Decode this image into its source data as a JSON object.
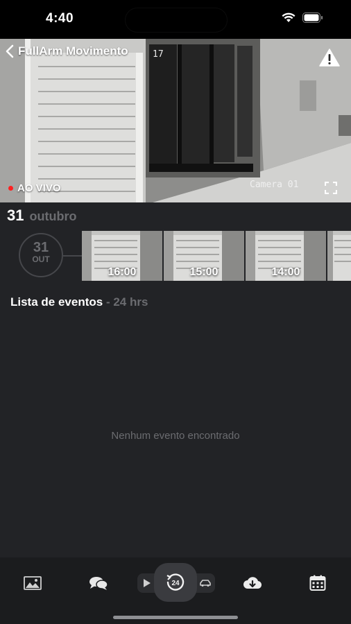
{
  "status_bar": {
    "time": "4:40"
  },
  "camera": {
    "title": "FullArm Movimento",
    "osd_time": "17",
    "live_label": "AO VIVO",
    "osd_camera": "Camera 01"
  },
  "date": {
    "day": "31",
    "month": "outubro"
  },
  "timeline": {
    "day": "31",
    "month_short": "OUT",
    "thumbnails": [
      {
        "time": "16:00"
      },
      {
        "time": "15:00"
      },
      {
        "time": "14:00"
      },
      {
        "time": ""
      }
    ]
  },
  "events": {
    "title": "Lista de eventos",
    "range": " - 24 hrs",
    "empty_message": "Nenhum evento encontrado"
  },
  "bottom_bar": {
    "icons": [
      "gallery-icon",
      "chat-icon",
      "play-icon",
      "history-24-icon",
      "car-icon",
      "cloud-download-icon",
      "calendar-icon"
    ]
  },
  "colors": {
    "background": "#222326",
    "muted": "#6b6c70",
    "live": "#ff2020"
  }
}
